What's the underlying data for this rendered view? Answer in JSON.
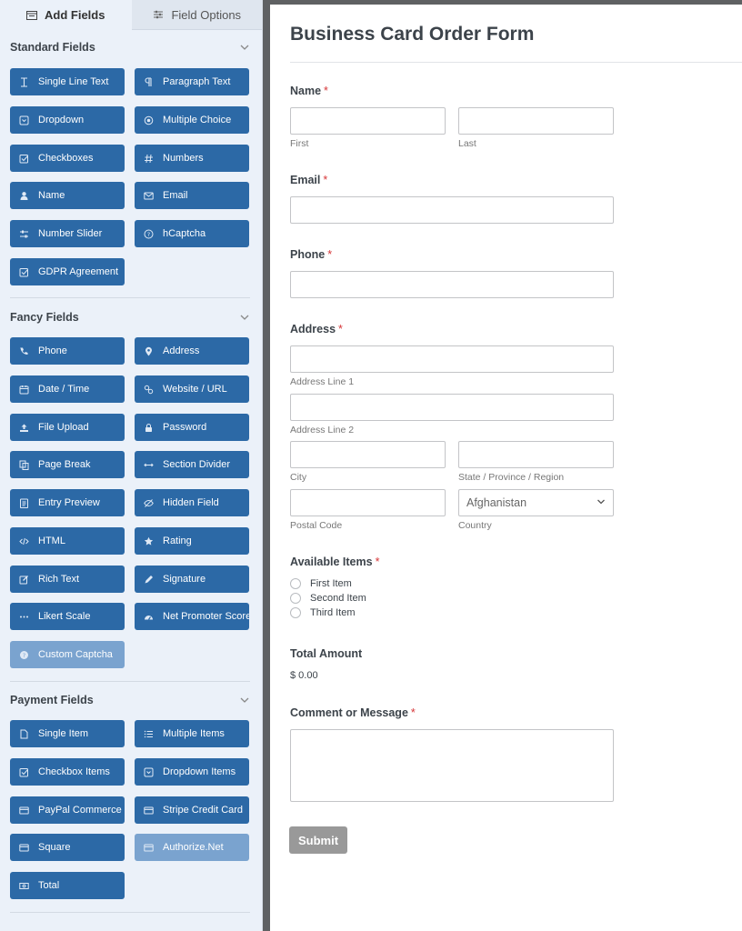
{
  "tabs": [
    {
      "label": "Add Fields",
      "icon": "add-fields-icon",
      "active": true
    },
    {
      "label": "Field Options",
      "icon": "sliders-icon",
      "active": false
    }
  ],
  "sections": [
    {
      "title": "Standard Fields",
      "items": [
        {
          "label": "Single Line Text",
          "icon": "text-cursor-icon"
        },
        {
          "label": "Paragraph Text",
          "icon": "paragraph-icon"
        },
        {
          "label": "Dropdown",
          "icon": "dropdown-icon"
        },
        {
          "label": "Multiple Choice",
          "icon": "radio-icon"
        },
        {
          "label": "Checkboxes",
          "icon": "checkbox-icon"
        },
        {
          "label": "Numbers",
          "icon": "hash-icon"
        },
        {
          "label": "Name",
          "icon": "user-icon"
        },
        {
          "label": "Email",
          "icon": "envelope-icon"
        },
        {
          "label": "Number Slider",
          "icon": "slider-icon"
        },
        {
          "label": "hCaptcha",
          "icon": "question-icon"
        },
        {
          "label": "GDPR Agreement",
          "icon": "checkbox-icon"
        }
      ]
    },
    {
      "title": "Fancy Fields",
      "items": [
        {
          "label": "Phone",
          "icon": "phone-icon"
        },
        {
          "label": "Address",
          "icon": "map-pin-icon"
        },
        {
          "label": "Date / Time",
          "icon": "calendar-icon"
        },
        {
          "label": "Website / URL",
          "icon": "link-icon"
        },
        {
          "label": "File Upload",
          "icon": "upload-icon"
        },
        {
          "label": "Password",
          "icon": "lock-icon"
        },
        {
          "label": "Page Break",
          "icon": "copy-icon"
        },
        {
          "label": "Section Divider",
          "icon": "arrows-h-icon"
        },
        {
          "label": "Entry Preview",
          "icon": "file-text-icon"
        },
        {
          "label": "Hidden Field",
          "icon": "eye-slash-icon"
        },
        {
          "label": "HTML",
          "icon": "code-icon"
        },
        {
          "label": "Rating",
          "icon": "star-icon"
        },
        {
          "label": "Rich Text",
          "icon": "edit-icon"
        },
        {
          "label": "Signature",
          "icon": "pen-icon"
        },
        {
          "label": "Likert Scale",
          "icon": "ellipsis-icon"
        },
        {
          "label": "Net Promoter Score",
          "icon": "gauge-icon"
        },
        {
          "label": "Custom Captcha",
          "icon": "question-circle-icon",
          "disabled": true
        }
      ]
    },
    {
      "title": "Payment Fields",
      "items": [
        {
          "label": "Single Item",
          "icon": "file-icon"
        },
        {
          "label": "Multiple Items",
          "icon": "list-icon"
        },
        {
          "label": "Checkbox Items",
          "icon": "checkbox-icon"
        },
        {
          "label": "Dropdown Items",
          "icon": "dropdown-icon"
        },
        {
          "label": "PayPal Commerce",
          "icon": "credit-card-icon"
        },
        {
          "label": "Stripe Credit Card",
          "icon": "credit-card-icon"
        },
        {
          "label": "Square",
          "icon": "credit-card-icon"
        },
        {
          "label": "Authorize.Net",
          "icon": "credit-card-icon",
          "disabled": true
        },
        {
          "label": "Total",
          "icon": "money-icon"
        }
      ]
    }
  ],
  "form": {
    "title": "Business Card Order Form",
    "name": {
      "label": "Name",
      "required": "*",
      "first": "First",
      "last": "Last"
    },
    "email": {
      "label": "Email",
      "required": "*"
    },
    "phone": {
      "label": "Phone",
      "required": "*"
    },
    "address": {
      "label": "Address",
      "required": "*",
      "line1": "Address Line 1",
      "line2": "Address Line 2",
      "city": "City",
      "state": "State / Province / Region",
      "postal": "Postal Code",
      "country": "Country",
      "country_value": "Afghanistan"
    },
    "items": {
      "label": "Available Items",
      "required": "*",
      "options": [
        "First Item",
        "Second Item",
        "Third Item"
      ]
    },
    "total": {
      "label": "Total Amount",
      "value": "$ 0.00"
    },
    "comment": {
      "label": "Comment or Message",
      "required": "*"
    },
    "submit": "Submit"
  },
  "colors": {
    "button": "#2c69a6",
    "button_disabled": "#7aa3cf",
    "panel_bg": "#ebf1f9",
    "required": "#d63638",
    "submit_bg": "#999999"
  }
}
